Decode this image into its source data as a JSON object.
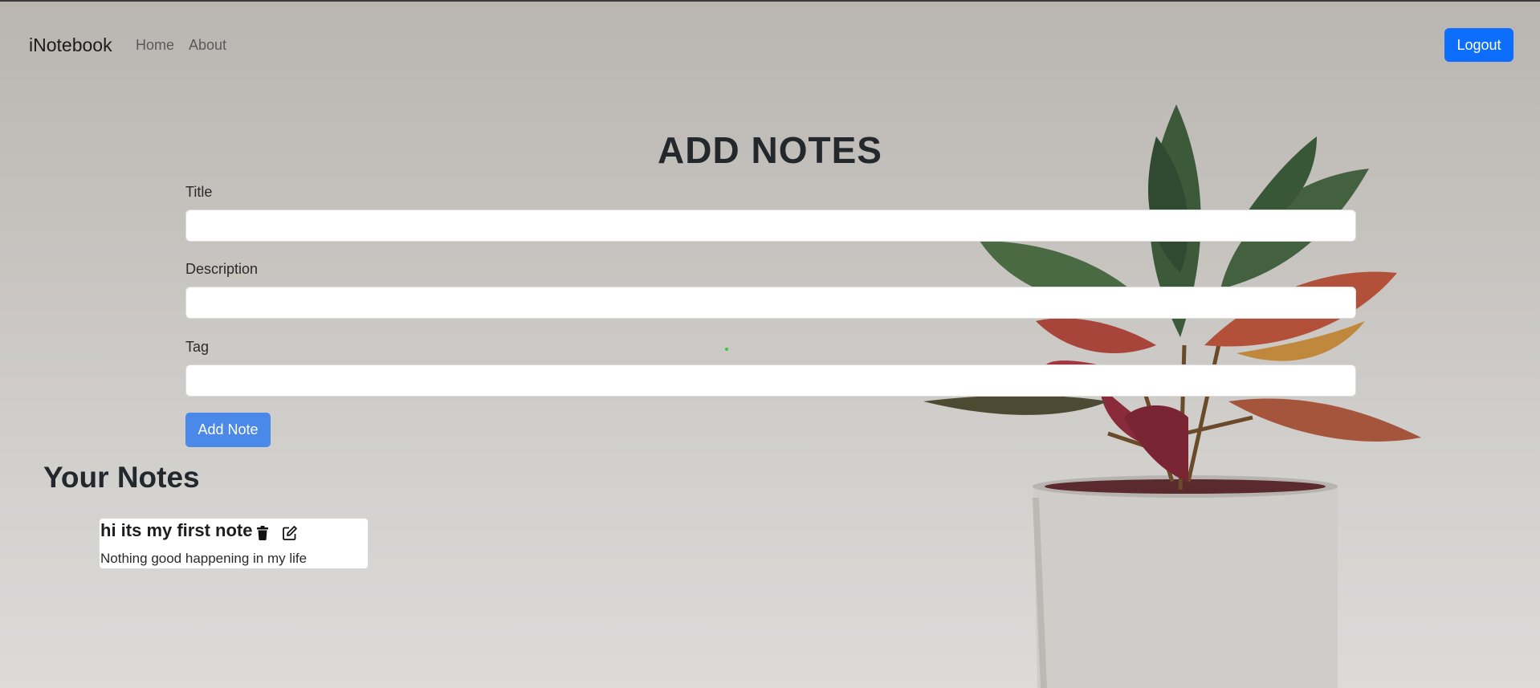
{
  "navbar": {
    "brand": "iNotebook",
    "links": [
      "Home",
      "About"
    ],
    "logout_label": "Logout"
  },
  "form": {
    "heading": "ADD NOTES",
    "title_label": "Title",
    "title_value": "",
    "description_label": "Description",
    "description_value": "",
    "tag_label": "Tag",
    "tag_value": "",
    "submit_label": "Add Note"
  },
  "notes": {
    "heading": "Your Notes",
    "items": [
      {
        "title": "hi its my first note",
        "description": "Nothing good happening in my life",
        "icons": [
          "trash-icon",
          "edit-icon"
        ]
      }
    ]
  },
  "colors": {
    "primary": "#0d6efd",
    "add_button": "#4a89e8",
    "heading": "#23282d"
  }
}
